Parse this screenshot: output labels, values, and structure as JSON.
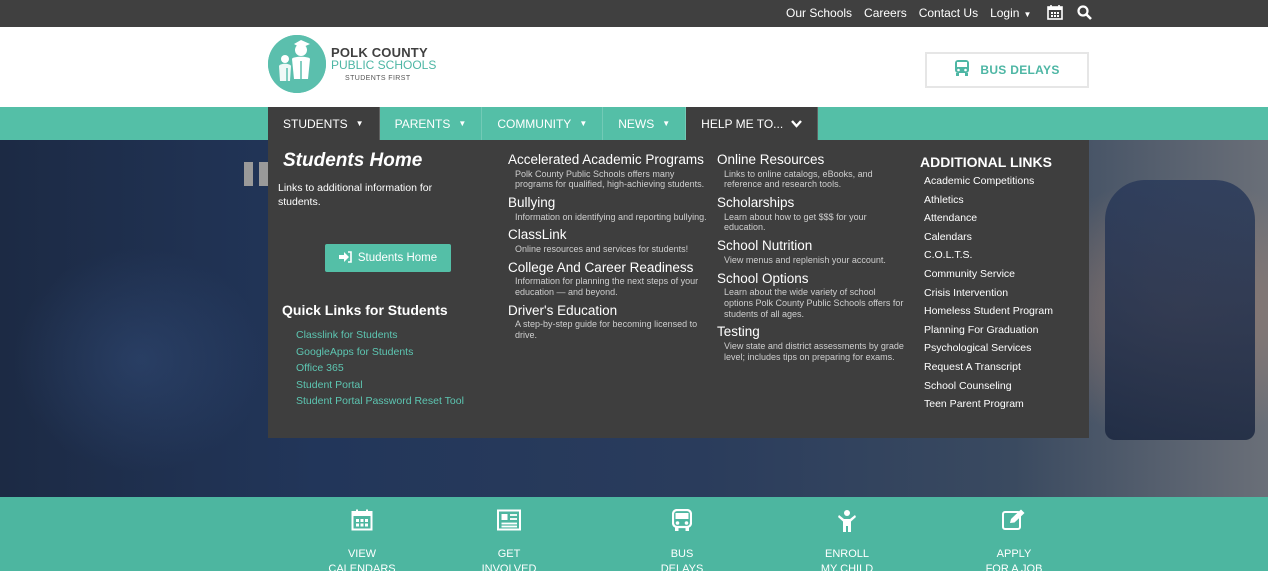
{
  "topbar": {
    "links": [
      "Our Schools",
      "Careers",
      "Contact Us",
      "Login"
    ],
    "icons": [
      "calendar-icon",
      "search-icon"
    ]
  },
  "logo": {
    "line1": "POLK COUNTY",
    "line2": "PUBLIC SCHOOLS",
    "tagline": "STUDENTS FIRST"
  },
  "bus_button": {
    "label": "BUS DELAYS"
  },
  "nav": {
    "students": "STUDENTS",
    "parents": "PARENTS",
    "community": "COMMUNITY",
    "news": "NEWS",
    "help": "HELP ME TO..."
  },
  "dropdown": {
    "title": "Students Home",
    "desc": "Links to additional information for students.",
    "home_button": "Students Home",
    "quick_links_title": "Quick Links for Students",
    "quick_links": [
      "Classlink for Students",
      "GoogleApps for Students",
      "Office 365",
      "Student Portal",
      "Student Portal Password Reset Tool"
    ],
    "col2": [
      {
        "title": "Accelerated Academic Programs",
        "desc": "Polk County Public Schools offers many programs for qualified, high-achieving students."
      },
      {
        "title": "Bullying",
        "desc": "Information on identifying and reporting bullying."
      },
      {
        "title": "ClassLink",
        "desc": "Online resources and services for students!"
      },
      {
        "title": "College And Career Readiness",
        "desc": "Information for planning the next steps of your education — and beyond."
      },
      {
        "title": "Driver's Education",
        "desc": "A step-by-step guide for becoming licensed to drive."
      }
    ],
    "col3": [
      {
        "title": "Online Resources",
        "desc": "Links to online catalogs, eBooks, and reference and research tools."
      },
      {
        "title": "Scholarships",
        "desc": "Learn about how to get $$$ for your education."
      },
      {
        "title": "School Nutrition",
        "desc": "View menus and replenish your account."
      },
      {
        "title": "School Options",
        "desc": "Learn about the wide variety of school options Polk County Public Schools offers for students of all ages."
      },
      {
        "title": "Testing",
        "desc": "View state and district assessments by grade level; includes tips on preparing for exams."
      }
    ],
    "additional_title": "ADDITIONAL LINKS",
    "additional": [
      "Academic Competitions",
      "Athletics",
      "Attendance",
      "Calendars",
      "C.O.L.T.S.",
      "Community Service",
      "Crisis Intervention",
      "Homeless Student Program",
      "Planning For Graduation",
      "Psychological Services",
      "Request A Transcript",
      "School Counseling",
      "Teen Parent Program"
    ]
  },
  "quickbar": [
    {
      "line1": "VIEW",
      "line2": "CALENDARS",
      "icon": "calendar-icon"
    },
    {
      "line1": "GET",
      "line2": "INVOLVED",
      "icon": "newspaper-icon"
    },
    {
      "line1": "BUS",
      "line2": "DELAYS",
      "icon": "bus-icon"
    },
    {
      "line1": "ENROLL",
      "line2": "MY CHILD",
      "icon": "child-icon"
    },
    {
      "line1": "APPLY",
      "line2": "FOR A JOB",
      "icon": "edit-icon"
    }
  ],
  "colors": {
    "teal": "#54bfa7",
    "dark": "#3e3e3e",
    "topbar": "#404040"
  }
}
